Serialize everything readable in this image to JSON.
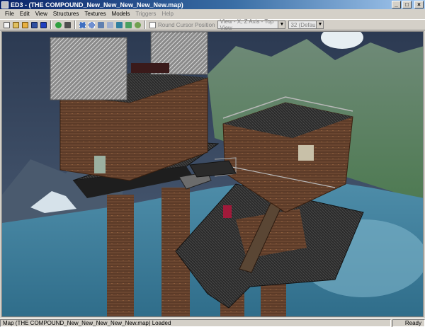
{
  "window": {
    "title": "ED3 - (THE COMPOUND_New_New_New_New_New.map)"
  },
  "titlebar_buttons": {
    "minimize": "_",
    "maximize": "□",
    "close": "×"
  },
  "menu": [
    {
      "label": "File",
      "enabled": true
    },
    {
      "label": "Edit",
      "enabled": true
    },
    {
      "label": "View",
      "enabled": true
    },
    {
      "label": "Structures",
      "enabled": true
    },
    {
      "label": "Textures",
      "enabled": true
    },
    {
      "label": "Models",
      "enabled": true
    },
    {
      "label": "Triggers",
      "enabled": false
    },
    {
      "label": "Help",
      "enabled": false
    }
  ],
  "toolbar": {
    "icons": [
      "new-map-icon",
      "open-icon",
      "open-folder-icon",
      "save-icon",
      "save-as-icon",
      "green-sphere-icon",
      "fill-icon",
      "grid-icon",
      "select-icon",
      "view-icon",
      "texture-icon",
      "model-icon",
      "render-icon",
      "help-icon"
    ],
    "round_cursor_label": "Round Cursor Position",
    "view_combo": "View - X, Z Axis - Top View",
    "size_combo": "32 (Default)",
    "combo_arrow": "▼"
  },
  "status": {
    "message": "Map (THE COMPOUND_New_New_New_New_New.map) Loaded",
    "state": "Ready"
  },
  "colors": {
    "title_start": "#0a246a",
    "title_end": "#a6caf0",
    "sky": "#3a4e6a",
    "water": "#4e8aa8",
    "rust": "#6b4630",
    "dark_floor": "#2a2a2a"
  }
}
